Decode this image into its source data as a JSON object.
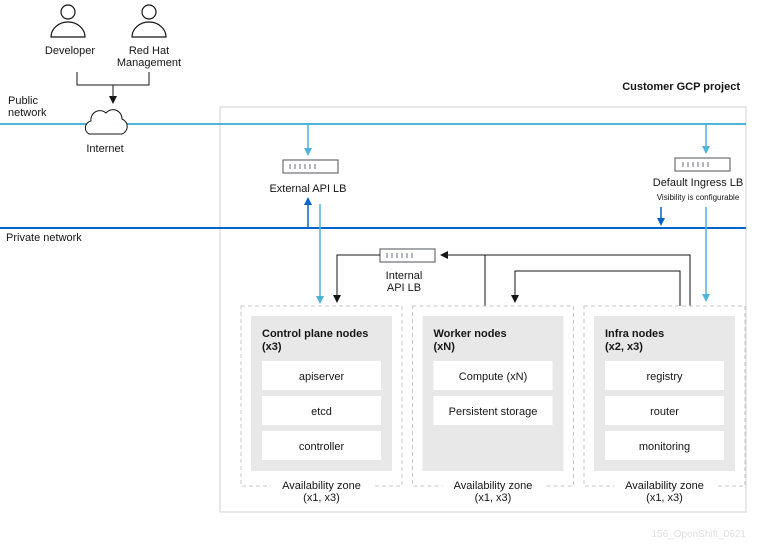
{
  "actors": [
    {
      "label": [
        "Developer"
      ]
    },
    {
      "label": [
        "Red Hat",
        "Management"
      ]
    }
  ],
  "public_network": [
    "Public",
    "network"
  ],
  "private_network": "Private network",
  "internet": "Internet",
  "project_title": "Customer GCP project",
  "external_lb": "External API LB",
  "ingress_lb": "Default Ingress LB",
  "ingress_note": "Visibility is configurable",
  "internal_lb": [
    "Internal",
    "API LB"
  ],
  "zones": [
    {
      "title": [
        "Control plane nodes",
        "(x3)"
      ],
      "items": [
        "apiserver",
        "etcd",
        "controller"
      ],
      "az": [
        "Availability zone",
        "(x1, x3)"
      ]
    },
    {
      "title": [
        "Worker nodes",
        "(xN)"
      ],
      "items": [
        "Compute (xN)",
        "Persistent storage"
      ],
      "az": [
        "Availability zone",
        "(x1, x3)"
      ]
    },
    {
      "title": [
        "Infra nodes",
        "(x2, x3)"
      ],
      "items": [
        "registry",
        "router",
        "monitoring"
      ],
      "az": [
        "Availability zone",
        "(x1, x3)"
      ]
    }
  ],
  "watermark": "156_OpenShift_0621",
  "colors": {
    "public": "#4fb3d9",
    "private": "#0066cc",
    "line": "#151515",
    "zone_bg": "#e8e8e8"
  }
}
